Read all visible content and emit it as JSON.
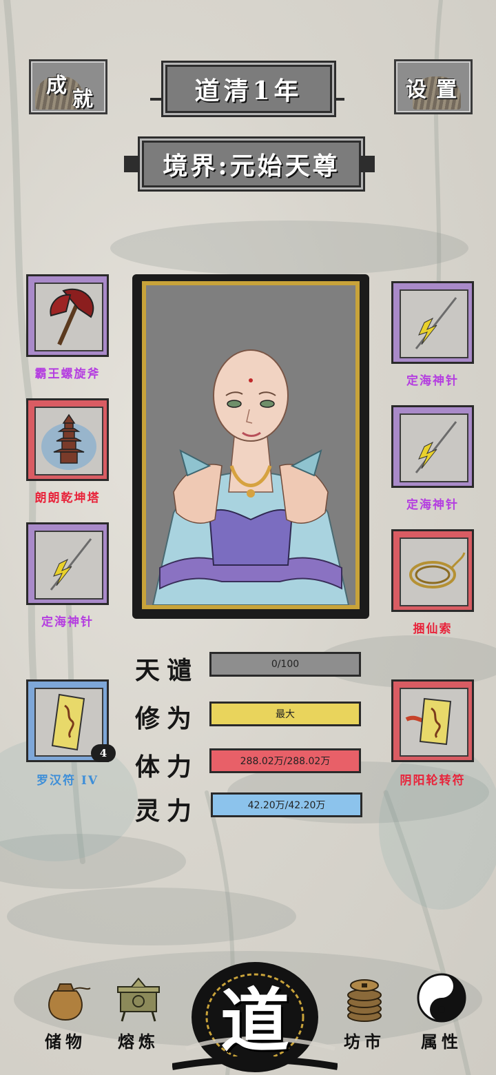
{
  "header": {
    "achievements_label": [
      "成",
      "就"
    ],
    "title": "道清1年",
    "settings_label": "设置",
    "realm": "境界:元始天尊"
  },
  "left_slots": [
    {
      "name": "霸王螺旋斧",
      "rarity": "purple",
      "icon": "battle-axe-icon"
    },
    {
      "name": "朗朗乾坤塔",
      "rarity": "red",
      "icon": "pagoda-icon"
    },
    {
      "name": "定海神针",
      "rarity": "purple",
      "icon": "lightning-spear-icon"
    },
    {
      "name": "罗汉符 IV",
      "rarity": "blue",
      "icon": "talisman-icon",
      "count": "4"
    }
  ],
  "right_slots": [
    {
      "name": "定海神针",
      "rarity": "purple",
      "icon": "lightning-spear-icon"
    },
    {
      "name": "定海神针",
      "rarity": "purple",
      "icon": "lightning-spear-icon"
    },
    {
      "name": "捆仙索",
      "rarity": "red",
      "icon": "rope-icon"
    },
    {
      "name": "阴阳轮转符",
      "rarity": "red",
      "icon": "talisman-icon"
    }
  ],
  "stats": [
    {
      "label": "天谴",
      "value": "0/100",
      "fill": 1.0,
      "color": "#8e8e8e"
    },
    {
      "label": "修为",
      "value": "最大",
      "fill": 1.0,
      "color": "#e9d45c"
    },
    {
      "label": "体力",
      "value": "288.02万/288.02万",
      "fill": 1.0,
      "color": "#e86068"
    },
    {
      "label": "灵力",
      "value": "42.20万/42.20万",
      "fill": 1.0,
      "color": "#8cc3ec"
    }
  ],
  "nav": {
    "storage": "储物",
    "forge": "熔炼",
    "center": "道",
    "market": "坊市",
    "attributes": "属性"
  },
  "colors": {
    "purple": "#a98ac9",
    "red": "#d95c63",
    "blue": "#7ea7d8"
  }
}
